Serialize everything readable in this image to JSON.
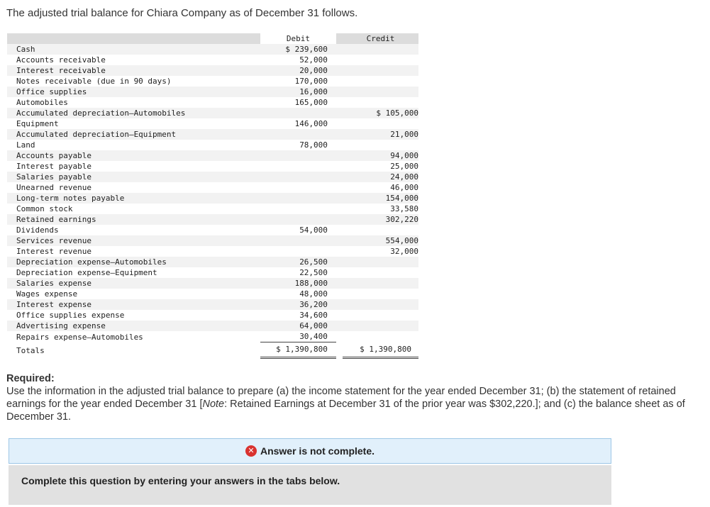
{
  "intro": "The adjusted trial balance for Chiara Company as of December 31 follows.",
  "trial_balance": {
    "header": {
      "debit": "Debit",
      "credit": "Credit"
    },
    "rows": [
      {
        "account": "Cash",
        "debit": "$ 239,600",
        "credit": ""
      },
      {
        "account": "Accounts receivable",
        "debit": "52,000",
        "credit": ""
      },
      {
        "account": "Interest receivable",
        "debit": "20,000",
        "credit": ""
      },
      {
        "account": "Notes receivable (due in 90 days)",
        "debit": "170,000",
        "credit": ""
      },
      {
        "account": "Office supplies",
        "debit": "16,000",
        "credit": ""
      },
      {
        "account": "Automobiles",
        "debit": "165,000",
        "credit": ""
      },
      {
        "account": "Accumulated depreciation—Automobiles",
        "debit": "",
        "credit": "$ 105,000"
      },
      {
        "account": "Equipment",
        "debit": "146,000",
        "credit": ""
      },
      {
        "account": "Accumulated depreciation—Equipment",
        "debit": "",
        "credit": "21,000"
      },
      {
        "account": "Land",
        "debit": "78,000",
        "credit": ""
      },
      {
        "account": "Accounts payable",
        "debit": "",
        "credit": "94,000"
      },
      {
        "account": "Interest payable",
        "debit": "",
        "credit": "25,000"
      },
      {
        "account": "Salaries payable",
        "debit": "",
        "credit": "24,000"
      },
      {
        "account": "Unearned revenue",
        "debit": "",
        "credit": "46,000"
      },
      {
        "account": "Long-term notes payable",
        "debit": "",
        "credit": "154,000"
      },
      {
        "account": "Common stock",
        "debit": "",
        "credit": "33,580"
      },
      {
        "account": "Retained earnings",
        "debit": "",
        "credit": "302,220"
      },
      {
        "account": "Dividends",
        "debit": "54,000",
        "credit": ""
      },
      {
        "account": "Services revenue",
        "debit": "",
        "credit": "554,000"
      },
      {
        "account": "Interest revenue",
        "debit": "",
        "credit": "32,000"
      },
      {
        "account": "Depreciation expense—Automobiles",
        "debit": "26,500",
        "credit": ""
      },
      {
        "account": "Depreciation expense—Equipment",
        "debit": "22,500",
        "credit": ""
      },
      {
        "account": "Salaries expense",
        "debit": "188,000",
        "credit": ""
      },
      {
        "account": "Wages expense",
        "debit": "48,000",
        "credit": ""
      },
      {
        "account": "Interest expense",
        "debit": "36,200",
        "credit": ""
      },
      {
        "account": "Office supplies expense",
        "debit": "34,600",
        "credit": ""
      },
      {
        "account": "Advertising expense",
        "debit": "64,000",
        "credit": ""
      },
      {
        "account": "Repairs expense—Automobiles",
        "debit": "30,400",
        "credit": ""
      }
    ],
    "totals": {
      "label": "Totals",
      "debit": "$ 1,390,800",
      "credit": "$ 1,390,800"
    }
  },
  "required": {
    "title": "Required:",
    "text_before_note": "Use the information in the adjusted trial balance to prepare (a) the income statement for the year ended December 31; (b) the statement of retained earnings for the year ended December 31 [",
    "note_label": "Note",
    "text_after_note": ": Retained Earnings at December 31 of the prior year was $302,220.]; and (c) the balance sheet as of December 31."
  },
  "status": {
    "icon": "x-circle-icon",
    "text": "Answer is not complete.",
    "icon_color": "#d9322f"
  },
  "instruction": "Complete this question by entering your answers in the tabs below."
}
